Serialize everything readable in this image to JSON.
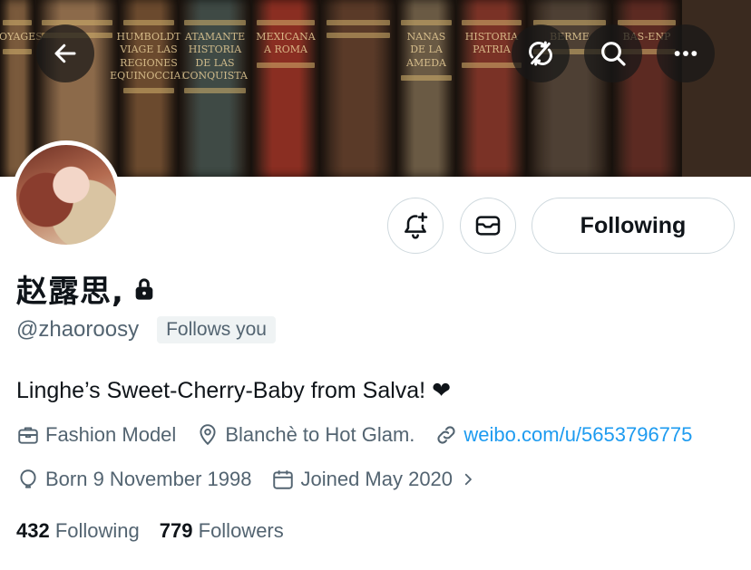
{
  "banner": {
    "spines": [
      {
        "text": "VOYAGES",
        "color": "#7a5a3c"
      },
      {
        "text": "",
        "color": "#8c6a4a"
      },
      {
        "text": "HUMBOLDT VIAGE LAS REGIONES EQUINOCCIAL",
        "color": "#6b4a2e"
      },
      {
        "text": "ATAMANTE HISTORIA DE LAS CONQUISTA",
        "color": "#3f4a45"
      },
      {
        "text": "MEXICANA A ROMA",
        "color": "#8a2e22"
      },
      {
        "text": "",
        "color": "#5a3a28"
      },
      {
        "text": "NANAS DE LA AMEDA",
        "color": "#6a5a44"
      },
      {
        "text": "HISTORIA PATRIA",
        "color": "#7a3226"
      },
      {
        "text": "BERME",
        "color": "#4e4034"
      },
      {
        "text": "BAS-ENP",
        "color": "#5c2a22"
      }
    ],
    "back_icon": "arrow-left-icon",
    "refresh_icon": "sync-off-icon",
    "search_icon": "search-icon",
    "more_icon": "more-horizontal-icon"
  },
  "profile": {
    "display_name": "赵露思,",
    "handle": "@zhaoroosy",
    "follows_you": "Follows you",
    "bio": "Linghe’s Sweet-Cherry-Baby from Salva! ❤",
    "following_button": "Following",
    "category": "Fashion Model",
    "location": "Blanchè to Hot Glam.",
    "website": "weibo.com/u/5653796775",
    "birthday": "Born 9 November 1998",
    "joined": "Joined May 2020",
    "following_count": "432",
    "following_label": "Following",
    "followers_count": "779",
    "followers_label": "Followers"
  },
  "colors": {
    "text_primary": "#0f1419",
    "text_secondary": "#536471",
    "link": "#1d9bf0",
    "border": "#cfd9de"
  }
}
